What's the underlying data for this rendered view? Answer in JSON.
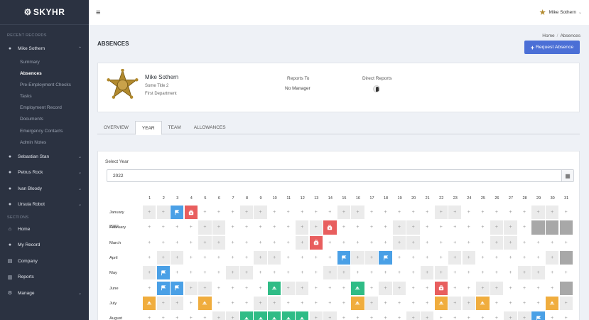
{
  "app": {
    "logo": "SKYHR"
  },
  "sidebar": {
    "recent_label": "RECENT RECORDS",
    "sections_label": "SECTIONS",
    "active_user": "Mike Sothern",
    "sub_items": [
      "Summary",
      "Absences",
      "Pre-Employment Checks",
      "Tasks",
      "Employment Record",
      "Documents",
      "Emergency Contacts",
      "Admin Notes"
    ],
    "other_users": [
      "Sebastian Stan",
      "Petrus Rock",
      "Ivan Bloody",
      "Ursula Robot"
    ],
    "sections": [
      {
        "label": "Home",
        "icon": "home-icon"
      },
      {
        "label": "My Record",
        "icon": "user-icon"
      },
      {
        "label": "Company",
        "icon": "building-icon"
      },
      {
        "label": "Reports",
        "icon": "chart-icon"
      },
      {
        "label": "Manage",
        "icon": "gear-icon"
      }
    ]
  },
  "topbar": {
    "user": "Mike Sothern"
  },
  "page": {
    "title": "ABSENCES"
  },
  "breadcrumb": {
    "home": "Home",
    "current": "Absences"
  },
  "request_button": "Request Absence",
  "profile": {
    "name": "Mike Sothern",
    "title": "Some Title 2",
    "department": "First Department",
    "reports_to_label": "Reports To",
    "reports_to_value": "No Manager",
    "direct_reports_label": "Direct Reports"
  },
  "tabs": [
    "OVERVIEW",
    "YEAR",
    "TEAM",
    "ALLOWANCES"
  ],
  "active_tab": "YEAR",
  "calendar": {
    "select_label": "Select Year",
    "year": "2022",
    "months": [
      {
        "name": "January 2022",
        "days": {
          "1": "w",
          "2": "w",
          "3": "flag",
          "4": "sick",
          "8": "w",
          "9": "w",
          "15": "w",
          "16": "w",
          "22": "w",
          "23": "w",
          "29": "w",
          "30": "w"
        }
      },
      {
        "name": "February",
        "days": {
          "5": "w",
          "6": "w",
          "12": "w",
          "13": "w",
          "14": "sick",
          "19": "w",
          "20": "w",
          "26": "w",
          "27": "w",
          "29": "x",
          "30": "x",
          "31": "x"
        }
      },
      {
        "name": "March",
        "days": {
          "5": "w",
          "6": "w",
          "12": "w",
          "13": "sick",
          "19": "w",
          "20": "w",
          "26": "w",
          "27": "w"
        }
      },
      {
        "name": "April",
        "days": {
          "2": "w",
          "3": "w",
          "9": "w",
          "10": "w",
          "15": "flag",
          "16": "w",
          "17": "w",
          "18": "flag",
          "23": "w",
          "24": "w",
          "30": "w",
          "31": "x"
        }
      },
      {
        "name": "May",
        "days": {
          "1": "w",
          "2": "flag",
          "7": "w",
          "8": "w",
          "14": "w",
          "15": "w",
          "21": "w",
          "22": "w",
          "28": "w",
          "29": "w"
        }
      },
      {
        "name": "June",
        "days": {
          "2": "flag",
          "3": "flag",
          "4": "w",
          "5": "w",
          "10": "green",
          "11": "w",
          "12": "w",
          "16": "green",
          "18": "w",
          "19": "w",
          "22": "sick",
          "25": "w",
          "26": "w",
          "31": "x"
        }
      },
      {
        "name": "July",
        "days": {
          "1": "hol",
          "2": "w",
          "3": "w",
          "5": "hol",
          "9": "w",
          "10": "w",
          "16": "hol",
          "17": "w",
          "22": "hol",
          "23": "w",
          "24": "w",
          "25": "hol",
          "30": "hol",
          "31": "w"
        }
      },
      {
        "name": "August",
        "days": {
          "6": "w",
          "7": "w",
          "8": "green",
          "9": "green",
          "10": "green",
          "11": "green",
          "12": "green",
          "13": "w",
          "14": "w",
          "20": "w",
          "21": "w",
          "27": "w",
          "28": "w",
          "29": "flag"
        }
      }
    ]
  },
  "colors": {
    "sidebar": "#2b3241",
    "primary": "#4b6fd6",
    "flag": "#4aa0e6",
    "sick": "#e85e5e",
    "holiday": "#f0ad3e",
    "green": "#2fbc86",
    "weekend": "#ebebeb"
  }
}
